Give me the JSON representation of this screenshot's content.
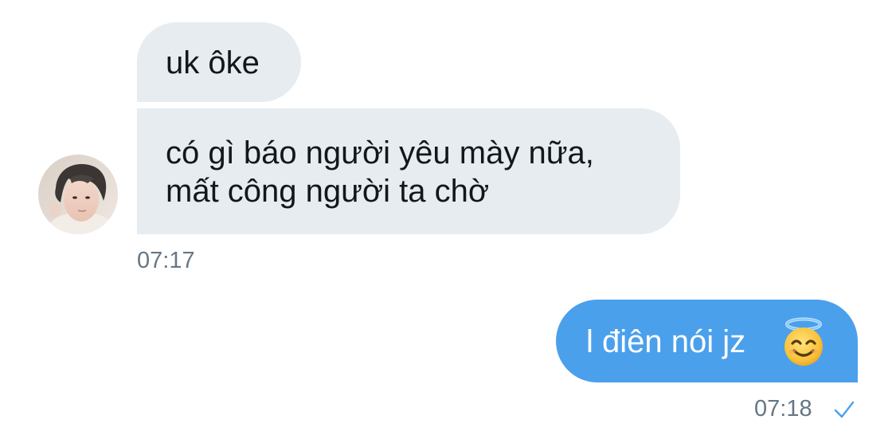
{
  "conversation": {
    "messages": [
      {
        "direction": "incoming",
        "text": "uk ôke"
      },
      {
        "direction": "incoming",
        "lines": [
          "có gì báo người yêu mày nữa,",
          "mất công người ta chờ"
        ]
      },
      {
        "direction": "outgoing",
        "text": "l điên nói jz",
        "emoji": "smiling-face-with-halo"
      }
    ],
    "timestamps": [
      "07:17",
      "07:18"
    ],
    "read_status_icon": "check-icon"
  },
  "colors": {
    "incoming_bubble": "#e6ecf0",
    "outgoing_bubble": "#4ba0eb",
    "timestamp_text": "#657786",
    "check_mark": "#4ba0eb"
  }
}
